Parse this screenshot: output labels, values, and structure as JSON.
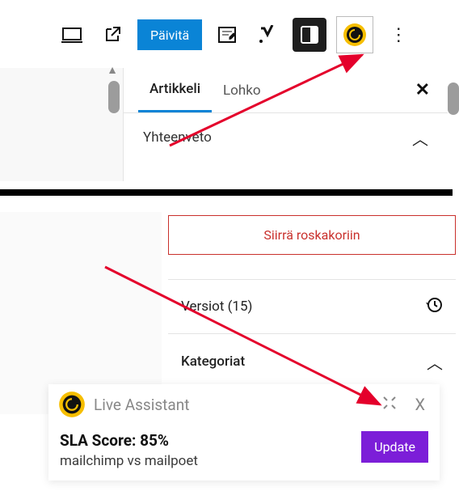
{
  "toolbar": {
    "publish_label": "Päivitä"
  },
  "sidebar": {
    "tabs": {
      "article": "Artikkeli",
      "block": "Lohko"
    },
    "section_summary": "Yhteenveto"
  },
  "panel2": {
    "trash_label": "Siirrä roskakoriin",
    "versions_label": "Versiot (15)",
    "categories_label": "Kategoriat"
  },
  "assistant": {
    "title": "Live Assistant",
    "score_label": "SLA Score:",
    "score_value": "85%",
    "subtitle": "mailchimp vs mailpoet",
    "update_label": "Update"
  }
}
